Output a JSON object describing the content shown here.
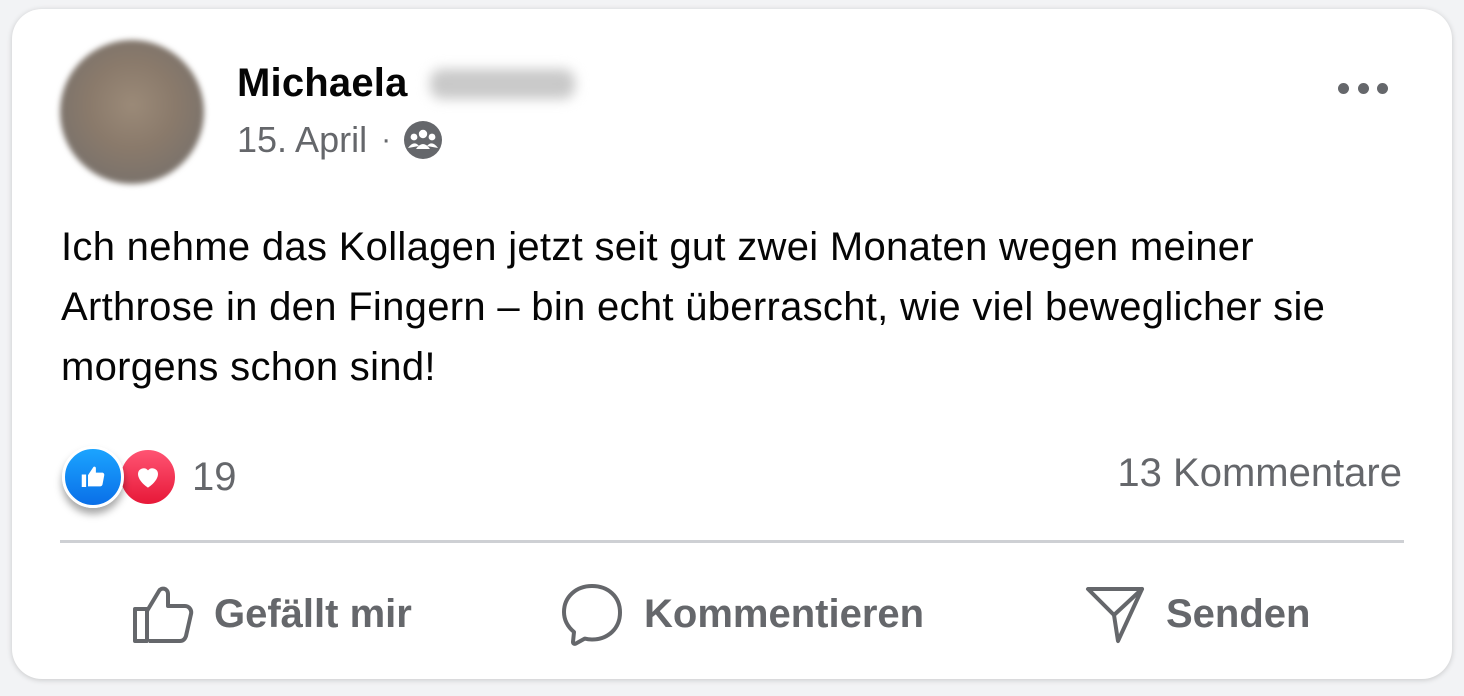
{
  "post": {
    "author_first_name": "Michaela",
    "date": "15. April",
    "separator": "·",
    "audience_icon": "group-icon",
    "text": "Ich nehme das Kollagen jetzt seit gut zwei Monaten wegen meiner Arthrose in den Fingern – bin echt überrascht, wie viel beweglicher sie morgens schon sind!"
  },
  "stats": {
    "reaction_count": "19",
    "reaction_types": [
      "like",
      "love"
    ],
    "comments_label": "13 Kommentare"
  },
  "actions": {
    "like_label": "Gefällt mir",
    "comment_label": "Kommentieren",
    "send_label": "Senden"
  },
  "colors": {
    "text_primary": "#050505",
    "text_secondary": "#65676b",
    "like_blue": "#1877f2",
    "love_red": "#f33e58",
    "divider": "#ced0d4"
  }
}
